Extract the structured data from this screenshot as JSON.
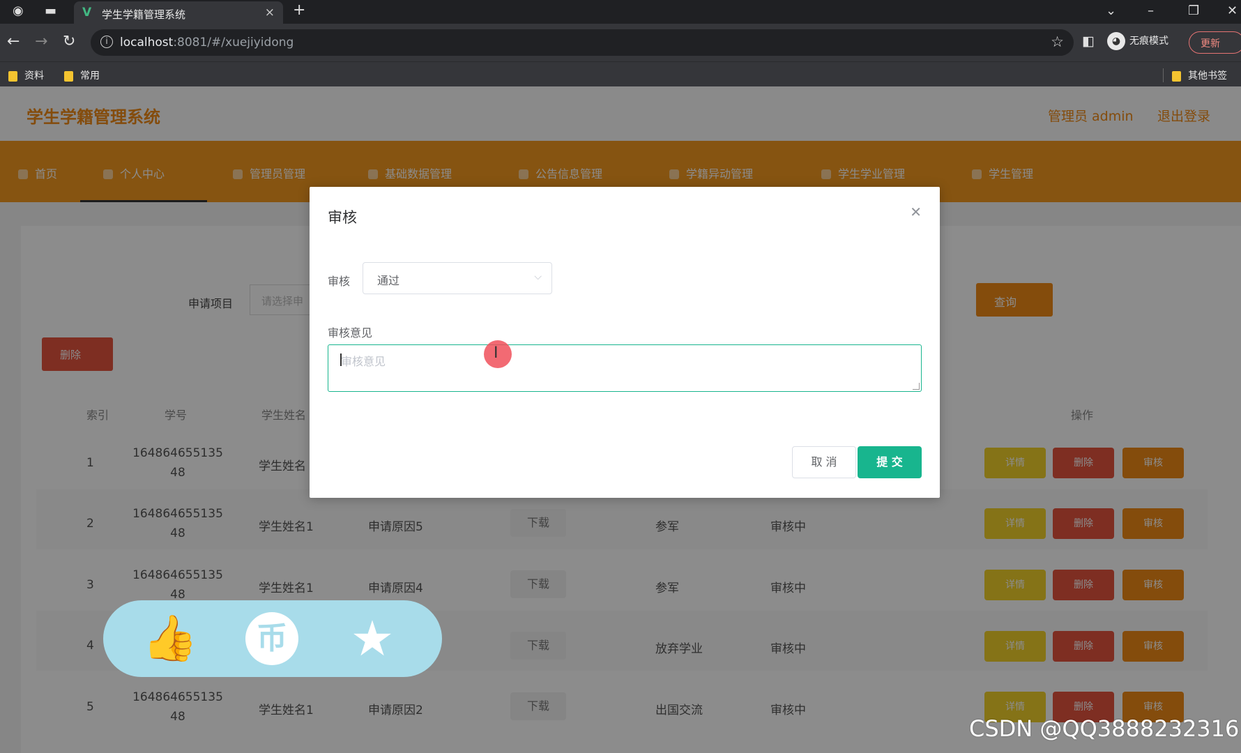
{
  "browser": {
    "tab_title": "学生学籍管理系统",
    "tab_favicon": "V",
    "url_host": "localhost",
    "url_path": ":8081/#/xuejiyidong",
    "incognito_label": "无痕模式",
    "update_label": "更新",
    "bookmarks": [
      "资料",
      "常用"
    ],
    "other_bookmarks": "其他书签"
  },
  "app": {
    "title": "学生学籍管理系统",
    "admin_label": "管理员 admin",
    "logout_label": "退出登录",
    "menu": [
      "首页",
      "个人中心",
      "管理员管理",
      "基础数据管理",
      "公告信息管理",
      "学籍异动管理",
      "学生学业管理",
      "学生管理"
    ],
    "search_label": "申请项目",
    "search_placeholder": "请选择申",
    "query_label": "查询",
    "delete_label": "删除",
    "table_headers": [
      "索引",
      "学号",
      "学生姓名",
      "操作"
    ],
    "row_actions": {
      "detail": "详情",
      "delete": "删除",
      "audit": "审核"
    },
    "rows": [
      {
        "index": "1",
        "student_id": "164864655135\n48",
        "name": "学生姓名",
        "reason": "",
        "download": "",
        "type": "",
        "status": ""
      },
      {
        "index": "2",
        "student_id": "164864655135\n48",
        "name": "学生姓名1",
        "reason": "申请原因5",
        "download": "下载",
        "type": "参军",
        "status": "审核中"
      },
      {
        "index": "3",
        "student_id": "164864655135\n48",
        "name": "学生姓名1",
        "reason": "申请原因4",
        "download": "下载",
        "type": "参军",
        "status": "审核中"
      },
      {
        "index": "4",
        "student_id": "",
        "name": "",
        "reason": "",
        "download": "下载",
        "type": "放弃学业",
        "status": "审核中"
      },
      {
        "index": "5",
        "student_id": "164864655135\n48",
        "name": "学生姓名1",
        "reason": "申请原因2",
        "download": "下载",
        "type": "出国交流",
        "status": "审核中"
      }
    ]
  },
  "dialog": {
    "title": "审核",
    "status_label": "审核",
    "status_value": "通过",
    "opinion_label": "审核意见",
    "opinion_placeholder": "审核意见",
    "cancel_label": "取 消",
    "submit_label": "提 交"
  },
  "social": {
    "coin_glyph": "币"
  },
  "watermark": "CSDN @QQ3888232316"
}
